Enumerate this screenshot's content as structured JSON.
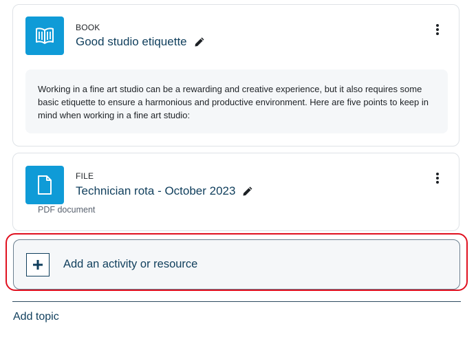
{
  "book": {
    "type": "BOOK",
    "title": "Good studio etiquette",
    "description": "Working in a fine art studio can be a rewarding and creative experience, but it also requires some basic etiquette to ensure a harmonious and productive environment. Here are five points to keep in mind when working in a fine art studio:",
    "icon": "book-icon"
  },
  "file": {
    "type": "FILE",
    "title": "Technician rota - October 2023",
    "subtext": "PDF document",
    "icon": "file-icon"
  },
  "add_activity": {
    "label": "Add an activity or resource",
    "icon": "plus-icon"
  },
  "add_topic": {
    "label": "Add topic"
  },
  "colors": {
    "accent": "#0f9bd7",
    "link": "#0f3e5c",
    "highlight": "#e0101f",
    "panel": "#f5f7f9"
  }
}
